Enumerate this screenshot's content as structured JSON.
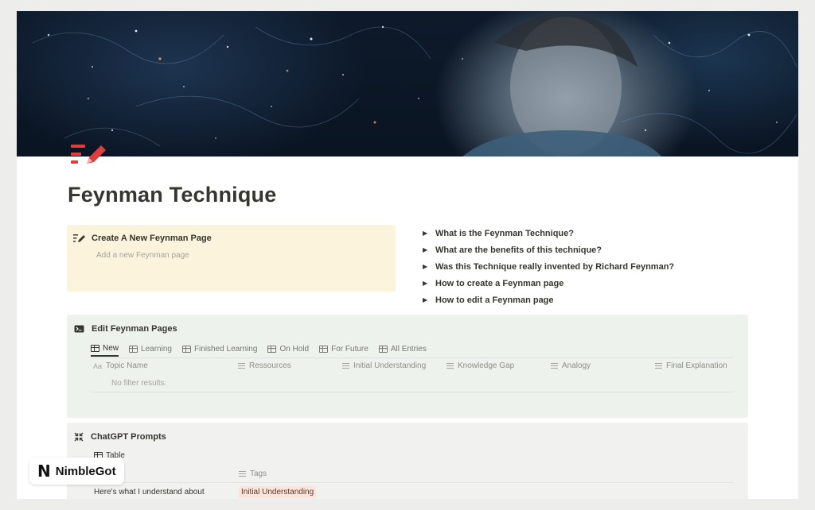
{
  "page": {
    "icon": "pencil-list-icon",
    "title": "Feynman Technique",
    "cover": "cover-image"
  },
  "callout": {
    "icon": "pencil-list-icon",
    "title": "Create A New Feynman Page",
    "placeholder": "Add a new Feynman page"
  },
  "toggles": [
    {
      "label": "What is the Feynman Technique?"
    },
    {
      "label": "What are the benefits of this technique?"
    },
    {
      "label": "Was this Technique really invented by Richard Feynman?"
    },
    {
      "label": "How to create a Feynman page"
    },
    {
      "label": "How to edit a Feynman page"
    }
  ],
  "edit_block": {
    "icon": "terminal-icon",
    "title": "Edit Feynman Pages",
    "tabs": [
      {
        "label": "New",
        "active": true
      },
      {
        "label": "Learning"
      },
      {
        "label": "Finished Learning"
      },
      {
        "label": "On Hold"
      },
      {
        "label": "For Future"
      },
      {
        "label": "All Entries"
      }
    ],
    "columns": [
      {
        "label": "Topic Name",
        "icon": "Aa"
      },
      {
        "label": "Ressources"
      },
      {
        "label": "Initial Understanding"
      },
      {
        "label": "Knowledge Gap"
      },
      {
        "label": "Analogy"
      },
      {
        "label": "Final Explanation"
      }
    ],
    "empty_text": "No filter results."
  },
  "prompts_block": {
    "icon": "compress-icon",
    "title": "ChatGPT Prompts",
    "tab": "Table",
    "tags_column": "Tags",
    "row_text": "Here's what I understand about",
    "row_tag": "Initial Understanding"
  },
  "brand": {
    "logo": "N",
    "name": "NimbleGot"
  },
  "colors": {
    "accent": "#e03e3e",
    "callout_bg": "#fbf3db",
    "green_block_bg": "#edf3ec",
    "gray_block_bg": "#f1f1ef"
  }
}
